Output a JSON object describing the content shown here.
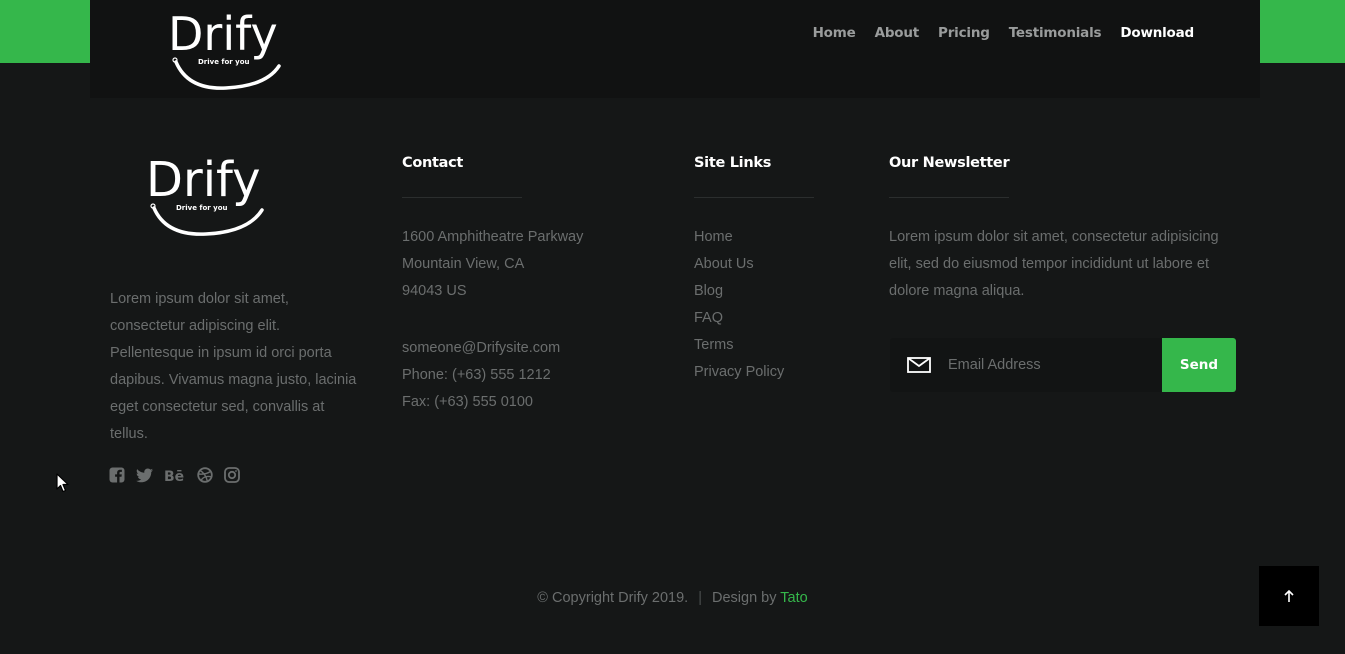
{
  "brand": {
    "name": "Drify",
    "tagline": "Drive for you",
    "accent": "#35b74b"
  },
  "nav": {
    "items": [
      {
        "label": "Home"
      },
      {
        "label": "About"
      },
      {
        "label": "Pricing"
      },
      {
        "label": "Testimonials"
      },
      {
        "label": "Download",
        "active": true
      }
    ]
  },
  "about": {
    "text": "Lorem ipsum dolor sit amet, consectetur adipiscing elit. Pellentesque in ipsum id orci porta dapibus. Vivamus magna justo, lacinia eget consectetur sed, convallis at tellus.",
    "socials": [
      "facebook-icon",
      "twitter-icon",
      "behance-icon",
      "dribbble-icon",
      "instagram-icon"
    ]
  },
  "contact": {
    "heading": "Contact",
    "address": [
      "1600 Amphitheatre Parkway",
      "Mountain View, CA",
      "94043 US"
    ],
    "email": "someone@Drifysite.com",
    "phone": "Phone: (+63) 555 1212",
    "fax": "Fax: (+63) 555 0100"
  },
  "site_links": {
    "heading": "Site Links",
    "items": [
      "Home",
      "About Us",
      "Blog",
      "FAQ",
      "Terms",
      "Privacy Policy"
    ]
  },
  "newsletter": {
    "heading": "Our Newsletter",
    "text": "Lorem ipsum dolor sit amet, consectetur adipisicing elit, sed do eiusmod tempor incididunt ut labore et dolore magna aliqua.",
    "placeholder": "Email Address",
    "value": "",
    "button": "Send"
  },
  "footer": {
    "copyright": "© Copyright Drify 2019.",
    "separator": "|",
    "design_prefix": "Design by",
    "author": "Tato"
  },
  "back_to_top": {
    "icon": "arrow-up-icon"
  }
}
